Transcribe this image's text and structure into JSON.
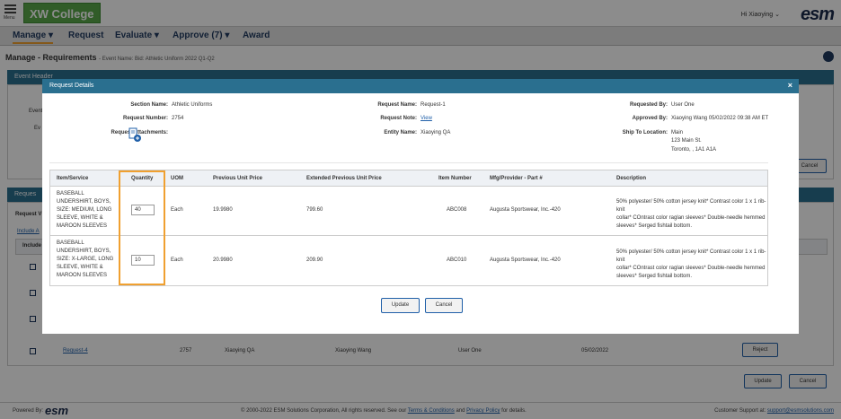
{
  "app": {
    "menu_label": "Menu",
    "logo_text": "XW College",
    "greeting": "Hi Xiaoying",
    "brand": "esm"
  },
  "nav": {
    "items": [
      {
        "label": "Manage"
      },
      {
        "label": "Request"
      },
      {
        "label": "Evaluate"
      },
      {
        "label": "Approve (7)"
      },
      {
        "label": "Award"
      }
    ]
  },
  "page": {
    "title": "Manage - Requirements",
    "event_name": "- Event Name: Bid: Athletic Uniform 2022 Q1-Q2",
    "event_header": "Event Header",
    "cancel_label": "Cancel",
    "requests_section": "Reques",
    "request_view_frag": "Request V",
    "include_link": "Include A",
    "include_col": "Include",
    "event_frag_1": "Event",
    "event_frag_2": "Ev",
    "row": {
      "request_link": "Request-4",
      "number": "2757",
      "entity": "Xiaoying QA",
      "approved_by": "Xiaoying Wang",
      "requested_by": "User One",
      "date": "05/02/2022",
      "reject_label": "Reject"
    },
    "update_label": "Update",
    "cancel_bottom_label": "Cancel"
  },
  "modal": {
    "title": "Request Details",
    "close_glyph": "×",
    "fields": {
      "section_name_label": "Section Name:",
      "section_name": "Athletic Uniforms",
      "request_number_label": "Request Number:",
      "request_number": "2754",
      "request_attachments_label": "Request Attachments:",
      "request_name_label": "Request Name:",
      "request_name": "Request-1",
      "request_note_label": "Request Note:",
      "request_note_link": "View",
      "entity_name_label": "Entity Name:",
      "entity_name": "Xiaoying QA",
      "requested_by_label": "Requested By:",
      "requested_by": "User One",
      "approved_by_label": "Approved By:",
      "approved_by": "Xiaoying Wang 05/02/2022 09:38 AM ET",
      "ship_to_label": "Ship To Location:",
      "ship_to_lines": [
        "Main",
        "123 Main St.",
        "Toronto, , 1A1 A1A"
      ]
    },
    "columns": [
      "Item/Service",
      "Quantity",
      "UOM",
      "Previous Unit Price",
      "Extended Previous Unit Price",
      "Item Number",
      "Mfg/Provider - Part #",
      "Description"
    ],
    "rows": [
      {
        "item": [
          "BASEBALL",
          "UNDERSHIRT, BOYS,",
          "SIZE: MEDIUM, LONG",
          "SLEEVE, WHITE &",
          "MAROON SLEEVES"
        ],
        "quantity": "40",
        "uom": "Each",
        "prev_price": "19.9980",
        "ext_price": "799.60",
        "item_number": "ABC008",
        "mfg": "Augusta Sportswear, Inc.-420",
        "description": [
          "50% polyester/ 50% cotton jersey knit* Contrast color 1 x 1 rib-knit",
          "collar* COntrast color raglan sleeves* Double-needle hemmed",
          "sleeves* Serged fishtail bottom."
        ]
      },
      {
        "item": [
          "BASEBALL",
          "UNDERSHIRT, BOYS,",
          "SIZE: X-LARGE, LONG",
          "SLEEVE, WHITE &",
          "MAROON SLEEVES"
        ],
        "quantity": "10",
        "uom": "Each",
        "prev_price": "20.9980",
        "ext_price": "209.90",
        "item_number": "ABC010",
        "mfg": "Augusta Sportswear, Inc.-420",
        "description": [
          "50% polyester/ 50% cotton jersey knit* Contrast color 1 x 1 rib-knit",
          "collar* COntrast color raglan sleeves* Double-needle hemmed",
          "sleeves* Serged fishtail bottom."
        ]
      }
    ],
    "update_label": "Update",
    "cancel_label": "Cancel"
  },
  "footer": {
    "powered_by": "Powered By:",
    "brand": "esm",
    "copyright_pre": "© 2000-2022 ESM Solutions Corporation, All rights reserved. See our",
    "terms_link": "Terms & Conditions",
    "and": "and",
    "privacy_link": "Privacy Policy",
    "copyright_post": "for details.",
    "support_label": "Customer Support at:",
    "support_email": "support@esmsolutions.com"
  },
  "colors": {
    "accent": "#2a6f8f",
    "highlight": "#f0a030",
    "logo_green": "#5aa84a",
    "link": "#1f5fa8"
  }
}
